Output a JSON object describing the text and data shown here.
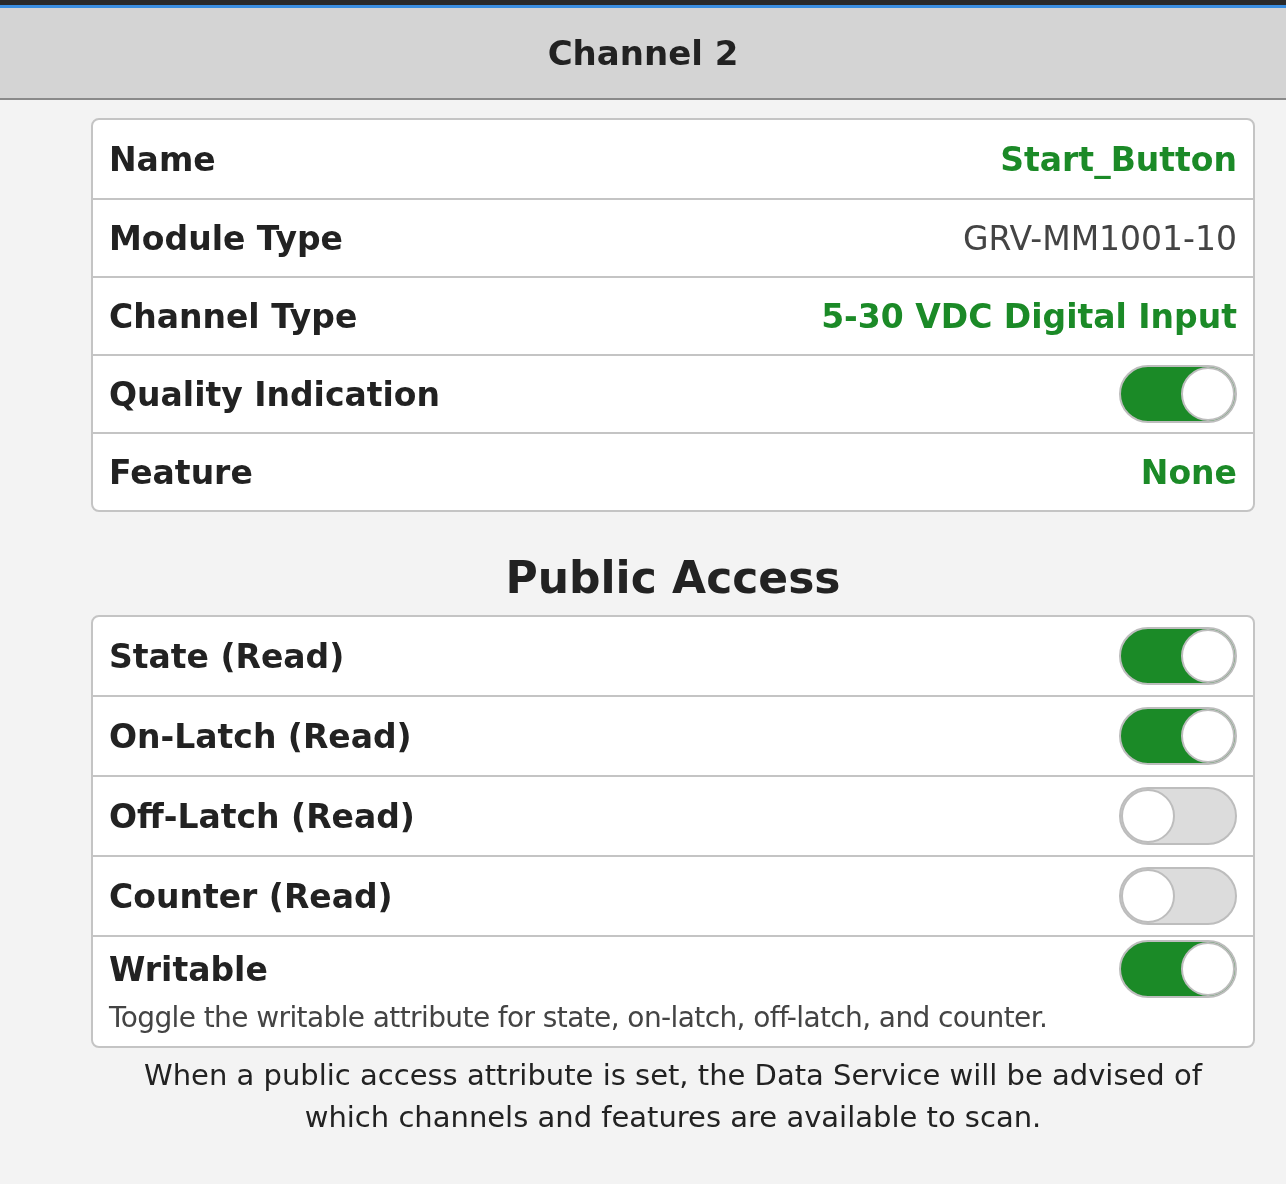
{
  "window": {
    "title": "Channel 2"
  },
  "details": [
    {
      "label": "Name",
      "kind": "choice",
      "value": "Start_Button"
    },
    {
      "label": "Module Type",
      "kind": "text",
      "value": "GRV-MM1001-10"
    },
    {
      "label": "Channel Type",
      "kind": "choice",
      "value": "5-30 VDC Digital Input"
    },
    {
      "label": "Quality Indication",
      "kind": "toggle",
      "on": true
    },
    {
      "label": "Feature",
      "kind": "choice",
      "value": "None"
    }
  ],
  "public_access": {
    "title": "Public Access",
    "items": [
      {
        "label": "State (Read)",
        "on": true
      },
      {
        "label": "On-Latch (Read)",
        "on": true
      },
      {
        "label": "Off-Latch (Read)",
        "on": false
      },
      {
        "label": "Counter (Read)",
        "on": false
      },
      {
        "label": "Writable",
        "on": true,
        "description": "Toggle the writable attribute for state, on-latch, off-latch, and counter."
      }
    ],
    "note": "When a public access attribute is set, the Data Service will be advised of which channels and features are available to scan."
  }
}
